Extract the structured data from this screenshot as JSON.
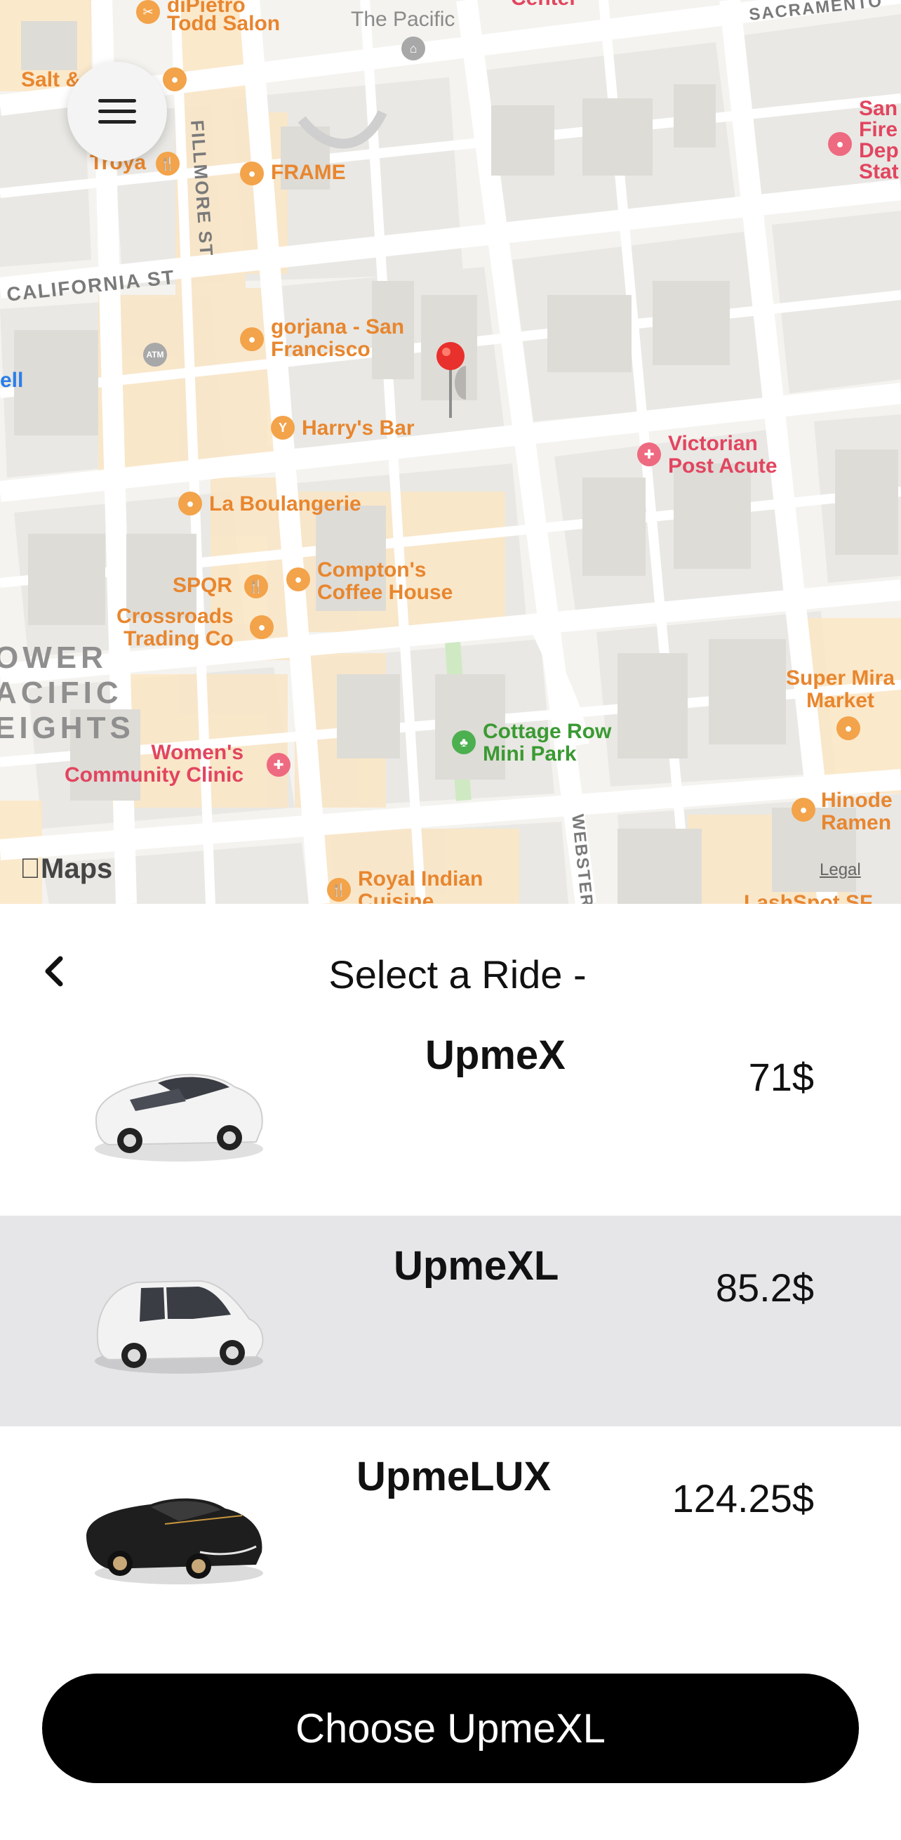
{
  "map": {
    "pois": {
      "dipietro": "diPietro",
      "todd_salon": "Todd Salon",
      "the_pacific": "The Pacific",
      "salt": "Salt &",
      "troya": "Troya",
      "frame": "FRAME",
      "gorjana": "gorjana - San\nFrancisco",
      "harrys_bar": "Harry's Bar",
      "la_boulangerie": "La Boulangerie",
      "victorian": "Victorian\nPost Acute",
      "spqr": "SPQR",
      "comptons": "Compton's\nCoffee House",
      "crossroads": "Crossroads\nTrading Co",
      "womens_clinic": "Women's\nCommunity Clinic",
      "cottage_row": "Cottage Row\nMini Park",
      "super_mira": "Super Mira\nMarket",
      "hinode": "Hinode\nRamen",
      "royal_indian": "Royal Indian\nCuisine",
      "lashspot": "LashSpot SF",
      "san_fire": "San\nFire\nDep\nStat",
      "ell": "ell",
      "center": "Center"
    },
    "streets": {
      "california": "CALIFORNIA ST",
      "fillmore": "FILLMORE ST",
      "sacramento": "SACRAMENTO",
      "webster": "WEBSTER"
    },
    "neighborhood": "OWER\nACIFIC\nEIGHTS",
    "atm": "ATM",
    "maps_logo": "Maps",
    "legal": "Legal"
  },
  "sheet": {
    "title": "Select a Ride -",
    "rides": [
      {
        "name": "UpmeX",
        "price": "71$",
        "car": "white-sedan"
      },
      {
        "name": "UpmeXL",
        "price": "85.2$",
        "car": "white-minivan"
      },
      {
        "name": "UpmeLUX",
        "price": "124.25$",
        "car": "black-sedan"
      }
    ],
    "selected_ride": "UpmeXL",
    "choose_label": "Choose UpmeXL"
  },
  "colors": {
    "selected_row": "#e6e6e9",
    "button": "#000000",
    "pin": "#e8302c"
  }
}
